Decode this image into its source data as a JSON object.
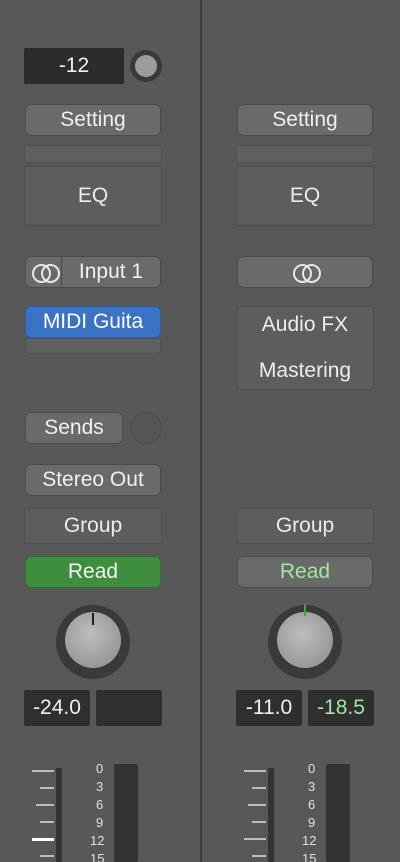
{
  "left": {
    "gain_value": "-12",
    "setting_label": "Setting",
    "eq_label": "EQ",
    "input_label": "Input 1",
    "instrument_label": "MIDI Guita",
    "sends_label": "Sends",
    "output_label": "Stereo Out",
    "group_label": "Group",
    "automation_label": "Read",
    "volume_value": "-24.0",
    "peak_value": ""
  },
  "right": {
    "setting_label": "Setting",
    "eq_label": "EQ",
    "audio_fx_line1": "Audio FX",
    "audio_fx_line2": "Mastering",
    "group_label": "Group",
    "automation_label": "Read",
    "volume_value": "-11.0",
    "peak_value": "-18.5"
  },
  "meter_scale": [
    "0",
    "3",
    "6",
    "9",
    "12",
    "15"
  ],
  "colors": {
    "read_active": "#3f8d3f",
    "read_text_inactive": "#9de89d",
    "instrument_blue": "#3a72c6",
    "peak_green": "#9de89d"
  }
}
